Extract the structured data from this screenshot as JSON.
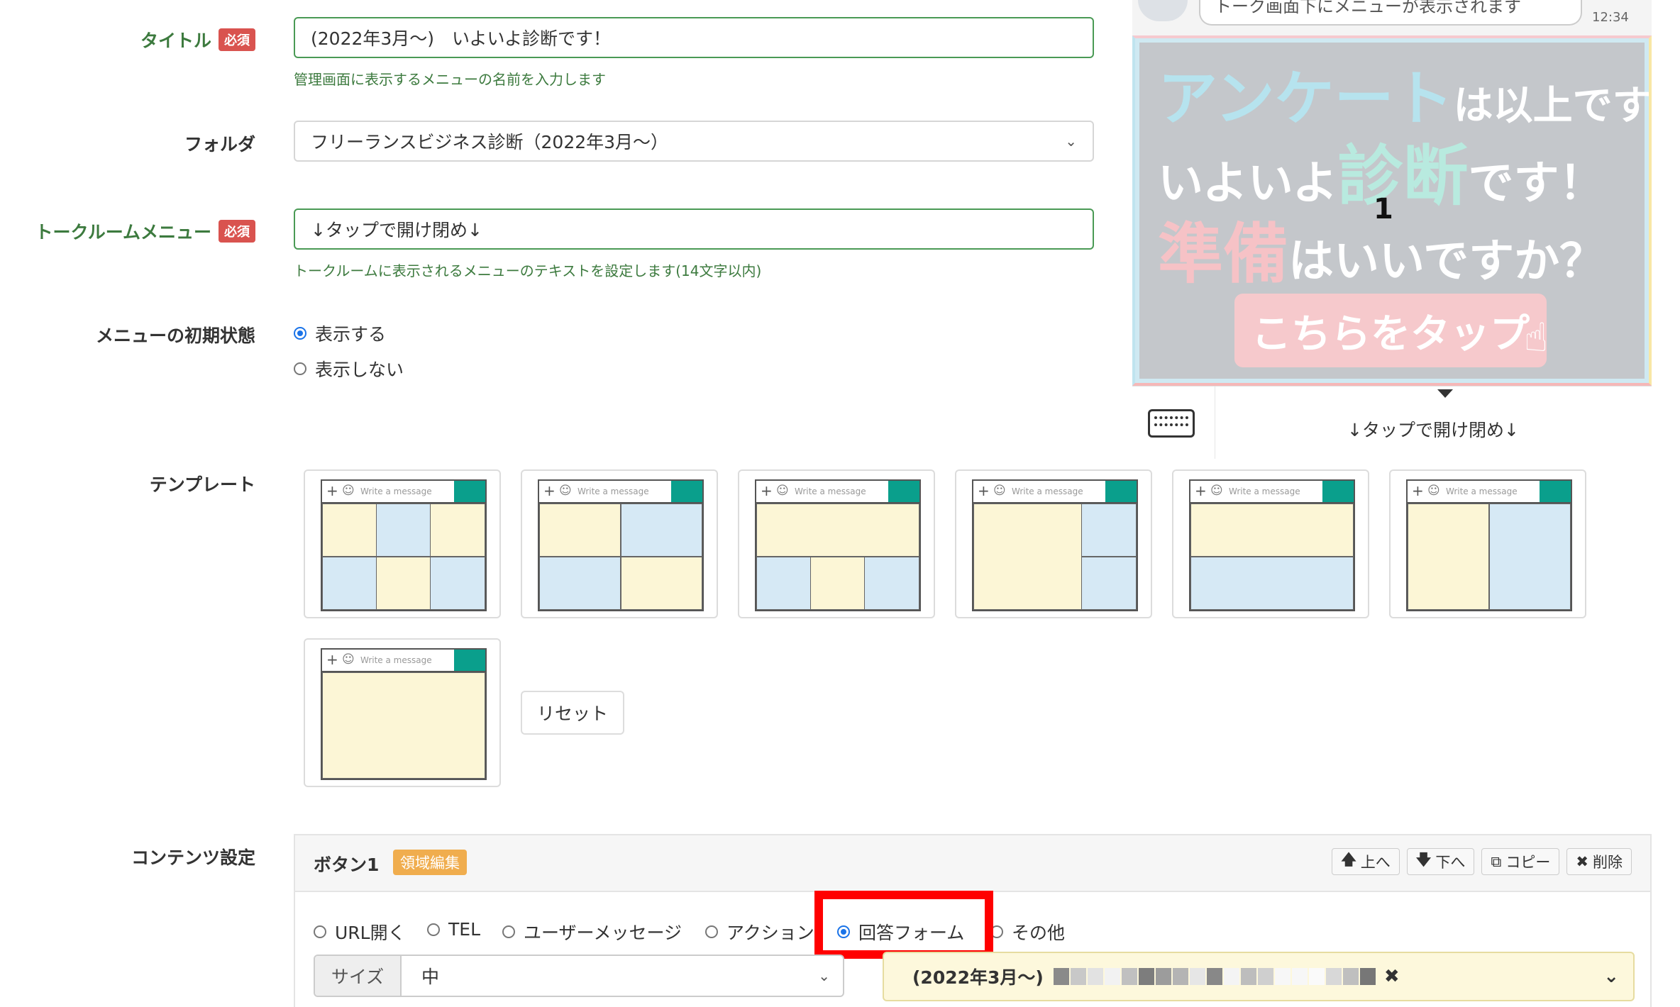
{
  "form": {
    "title_label": "タイトル",
    "required_badge": "必須",
    "title_value": "(2022年3月〜)　いよいよ診断です！",
    "title_help": "管理画面に表示するメニューの名前を入力します",
    "folder_label": "フォルダ",
    "folder_value": "フリーランスビジネス診断（2022年3月〜）",
    "menu_text_label": "トークルームメニュー",
    "menu_text_value": "↓タップで開け閉め↓",
    "menu_text_help": "トークルームに表示されるメニューのテキストを設定します(14文字以内)",
    "initial_state_label": "メニューの初期状態",
    "initial_state_options": [
      "表示する",
      "表示しない"
    ],
    "template_label": "テンプレート",
    "template_message_placeholder": "Write a message",
    "reset_label": "リセット",
    "content_label": "コンテンツ設定"
  },
  "preview": {
    "top_bubble": "トーク画面下にメニューが表示されます",
    "time": "12:34",
    "banner_line1_a": "アンケート",
    "banner_line1_b": "は以上です。",
    "banner_line2_a": "いよいよ",
    "banner_line2_b": "診断",
    "banner_line2_c": "です！",
    "banner_line3_a": "準備",
    "banner_line3_b": "はいいですか？",
    "banner_area_number": "1",
    "banner_cta": "こちらをタップ",
    "menu_bar_text": "↓タップで開け閉め↓"
  },
  "button_panel": {
    "title": "ボタン1",
    "area_edit_badge": "領域編集",
    "up_label": "上へ",
    "down_label": "下へ",
    "copy_label": "コピー",
    "delete_label": "削除",
    "action_types": [
      "URL開く",
      "TEL",
      "ユーザーメッセージ",
      "アクション",
      "回答フォーム",
      "その他"
    ],
    "selected_action": "回答フォーム",
    "size_label": "サイズ",
    "size_value": "中",
    "form_select_value": "(2022年3月〜)"
  },
  "colors": {
    "green_border": "#4a9a55",
    "required_red": "#d9534f",
    "badge_orange": "#f0ad4e",
    "highlight_red": "#ff0000",
    "teal": "#0a9f8c"
  }
}
